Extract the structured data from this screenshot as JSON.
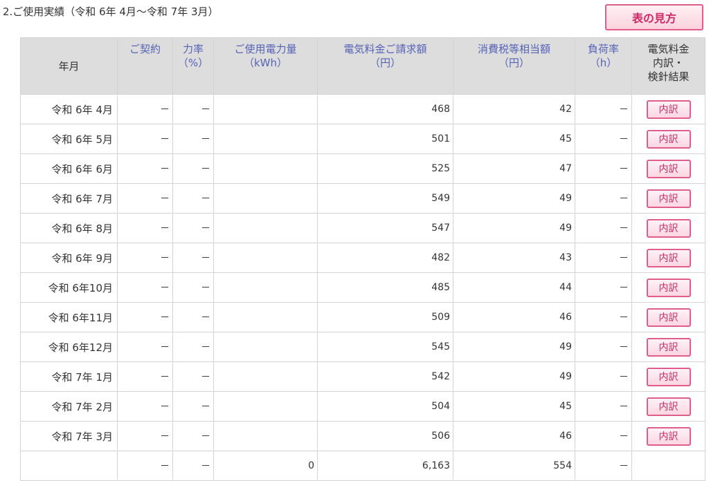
{
  "section_title": "2.ご使用実績（令和 6年 4月～令和 7年 3月）",
  "guide_button": "表の見方",
  "headers": {
    "month": "年月",
    "contract": "ご契約",
    "power_factor": {
      "l1": "力率",
      "l2": "（%）"
    },
    "usage": {
      "l1": "ご使用電力量",
      "l2": "（kWh）"
    },
    "charge": {
      "l1": "電気料金ご請求額",
      "l2": "（円）"
    },
    "tax": {
      "l1": "消費税等相当額",
      "l2": "（円）"
    },
    "load_factor": {
      "l1": "負荷率",
      "l2": "（h）"
    },
    "detail": {
      "l1": "電気料金",
      "l2": "内訳・",
      "l3": "検針結果"
    }
  },
  "colors": {
    "header_link": "#5662b6",
    "button_border": "#e05c8a",
    "button_text": "#cc2a63"
  },
  "detail_button_label": "内訳",
  "rows": [
    {
      "month": "令和 6年 4月",
      "contract": "－",
      "pf": "－",
      "usage": "",
      "charge": "468",
      "tax": "42",
      "lf": "－"
    },
    {
      "month": "令和 6年 5月",
      "contract": "－",
      "pf": "－",
      "usage": "",
      "charge": "501",
      "tax": "45",
      "lf": "－"
    },
    {
      "month": "令和 6年 6月",
      "contract": "－",
      "pf": "－",
      "usage": "",
      "charge": "525",
      "tax": "47",
      "lf": "－"
    },
    {
      "month": "令和 6年 7月",
      "contract": "－",
      "pf": "－",
      "usage": "",
      "charge": "549",
      "tax": "49",
      "lf": "－"
    },
    {
      "month": "令和 6年 8月",
      "contract": "－",
      "pf": "－",
      "usage": "",
      "charge": "547",
      "tax": "49",
      "lf": "－"
    },
    {
      "month": "令和 6年 9月",
      "contract": "－",
      "pf": "－",
      "usage": "",
      "charge": "482",
      "tax": "43",
      "lf": "－"
    },
    {
      "month": "令和 6年10月",
      "contract": "－",
      "pf": "－",
      "usage": "",
      "charge": "485",
      "tax": "44",
      "lf": "－"
    },
    {
      "month": "令和 6年11月",
      "contract": "－",
      "pf": "－",
      "usage": "",
      "charge": "509",
      "tax": "46",
      "lf": "－"
    },
    {
      "month": "令和 6年12月",
      "contract": "－",
      "pf": "－",
      "usage": "",
      "charge": "545",
      "tax": "49",
      "lf": "－"
    },
    {
      "month": "令和 7年 1月",
      "contract": "－",
      "pf": "－",
      "usage": "",
      "charge": "542",
      "tax": "49",
      "lf": "－"
    },
    {
      "month": "令和 7年 2月",
      "contract": "－",
      "pf": "－",
      "usage": "",
      "charge": "504",
      "tax": "45",
      "lf": "－"
    },
    {
      "month": "令和 7年 3月",
      "contract": "－",
      "pf": "－",
      "usage": "",
      "charge": "506",
      "tax": "46",
      "lf": "－"
    }
  ],
  "total": {
    "contract": "－",
    "pf": "－",
    "usage": "0",
    "charge": "6,163",
    "tax": "554",
    "lf": "－"
  }
}
